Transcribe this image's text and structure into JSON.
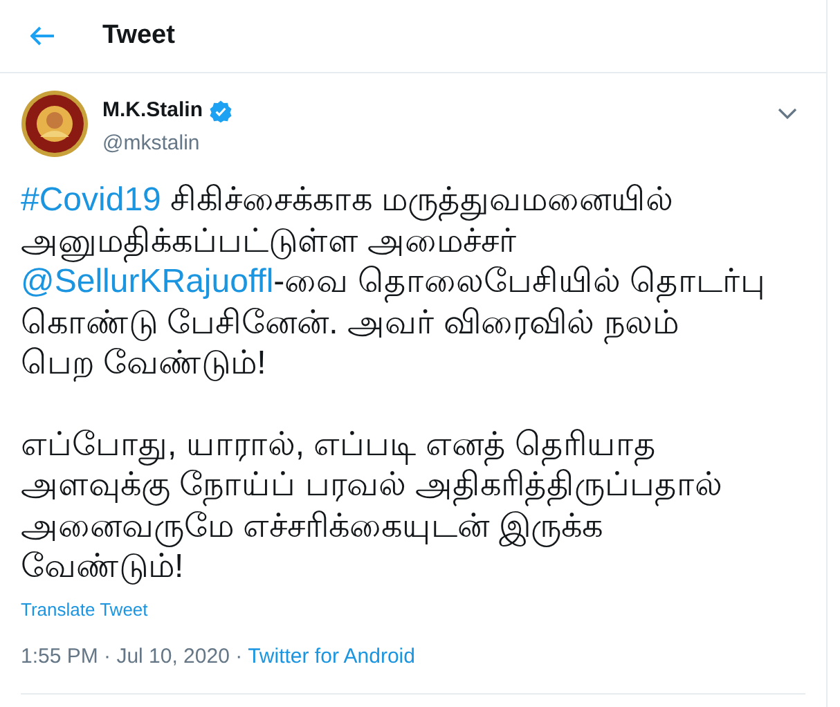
{
  "header": {
    "title": "Tweet"
  },
  "author": {
    "name": "M.K.Stalin",
    "verified": true,
    "handle": "@mkstalin"
  },
  "paragraphs": [
    [
      [
        {
          "kind": "hashtag",
          "text": "#Covid19"
        },
        {
          "kind": "text",
          "text": " சிகிச்சைக்காக மருத்துவமனையில்"
        }
      ],
      [
        {
          "kind": "text",
          "text": "அனுமதிக்கப்பட்டுள்ள அமைச்சர்"
        }
      ],
      [
        {
          "kind": "mention",
          "text": "@SellurKRajuoffl"
        },
        {
          "kind": "text",
          "text": "-வை தொலைபேசியில் தொடர்பு"
        }
      ],
      [
        {
          "kind": "text",
          "text": "கொண்டு பேசினேன். அவர் விரைவில் நலம்"
        }
      ],
      [
        {
          "kind": "text",
          "text": "பெற வேண்டும்!"
        }
      ]
    ],
    [
      [
        {
          "kind": "text",
          "text": "எப்போது, யாரால், எப்படி எனத் தெரியாத"
        }
      ],
      [
        {
          "kind": "text",
          "text": "அளவுக்கு நோய்ப் பரவல் அதிகரித்திருப்பதால்"
        }
      ],
      [
        {
          "kind": "text",
          "text": "அனைவருமே எச்சரிக்கையுடன் இருக்க"
        }
      ],
      [
        {
          "kind": "text",
          "text": "வேண்டும்!"
        }
      ]
    ]
  ],
  "translate_link": "Translate Tweet",
  "timestamp": "1:55 PM · Jul 10, 2020 ·",
  "source": "Twitter for Android"
}
